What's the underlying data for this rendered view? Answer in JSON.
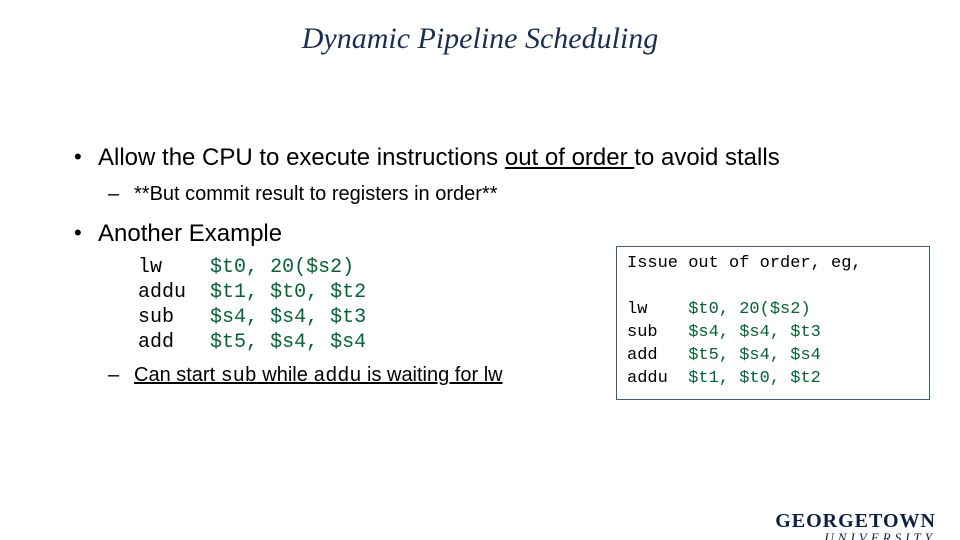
{
  "title": "Dynamic Pipeline Scheduling",
  "bullets": {
    "b1_pre": "Allow the CPU to execute instructions ",
    "b1_u": "out of order ",
    "b1_post": "to avoid stalls",
    "b1_sub": "**But commit result to registers in order**",
    "b2": "Another Example",
    "b2_sub_pre": "Can start ",
    "b2_sub_code1": "sub",
    "b2_sub_mid": " while ",
    "b2_sub_code2": "addu",
    "b2_sub_post": " is waiting for lw"
  },
  "code": {
    "rows": [
      {
        "op": "lw",
        "d": "$t0,",
        "a": "20($s2)",
        "b": ""
      },
      {
        "op": "addu",
        "d": "$t1,",
        "a": "$t0,",
        "b": "$t2"
      },
      {
        "op": "sub",
        "d": "$s4,",
        "a": "$s4,",
        "b": "$t3"
      },
      {
        "op": "add",
        "d": "$t5,",
        "a": "$s4,",
        "b": "$s4"
      }
    ]
  },
  "sidebox": {
    "heading": "Issue out of order, eg,",
    "rows": [
      {
        "op": "lw",
        "d": "$t0,",
        "a": "20($s2)",
        "b": ""
      },
      {
        "op": "sub",
        "d": "$s4,",
        "a": "$s4,",
        "b": "$t3"
      },
      {
        "op": "add",
        "d": "$t5,",
        "a": "$s4,",
        "b": "$s4"
      },
      {
        "op": "addu",
        "d": "$t1,",
        "a": "$t0,",
        "b": "$t2"
      }
    ]
  },
  "logo": {
    "line1": "GEORGETOWN",
    "line2": "UNIVERSITY"
  }
}
